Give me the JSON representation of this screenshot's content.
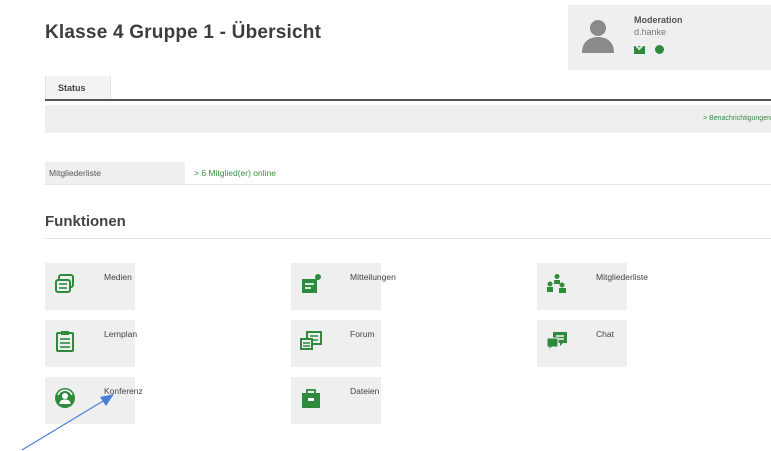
{
  "header": {
    "title": "Klasse 4 Gruppe 1 - Übersicht"
  },
  "moderation": {
    "label": "Moderation",
    "user": "d.hanke",
    "avatar_icon": "user-avatar-icon",
    "icons": [
      "envelope-icon",
      "online-status-icon"
    ]
  },
  "tabs": [
    {
      "label": "Status",
      "active": true
    }
  ],
  "notifications": {
    "link": "> Benachrichtigungen"
  },
  "members": {
    "label": "Mitgliederliste",
    "online": "> 6 Mitglied(er) online"
  },
  "functions": {
    "title": "Funktionen",
    "items": [
      {
        "label": "Medien",
        "icon": "media-icon"
      },
      {
        "label": "Mitteilungen",
        "icon": "messages-icon"
      },
      {
        "label": "Mitgliederliste",
        "icon": "member-list-icon"
      },
      {
        "label": "Lernplan",
        "icon": "learning-plan-icon"
      },
      {
        "label": "Forum",
        "icon": "forum-icon"
      },
      {
        "label": "Chat",
        "icon": "chat-icon"
      },
      {
        "label": "Konferenz",
        "icon": "conference-icon"
      },
      {
        "label": "Dateien",
        "icon": "files-icon"
      }
    ]
  },
  "colors": {
    "accent": "#2e8b3e",
    "panel": "#efefef"
  }
}
